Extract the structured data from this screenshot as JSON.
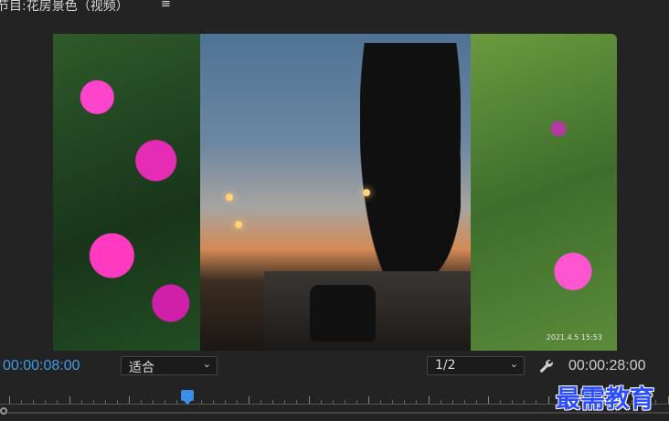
{
  "header": {
    "title": "节目:花房景色（视频）",
    "menu_icon": "hamburger-menu-icon"
  },
  "viewer": {
    "timestamp_overlay": "2021.4.5 15:53"
  },
  "controls": {
    "current_timecode": "00:00:08:00",
    "fit_select": "适合",
    "resolution_select": "1/2",
    "settings_icon": "wrench-icon",
    "duration_timecode": "00:00:28:00"
  },
  "timeline": {
    "watermark": "最需教育"
  },
  "colors": {
    "timecode_blue": "#3f9ae8",
    "background": "#232323",
    "playhead": "#3d8de8"
  }
}
